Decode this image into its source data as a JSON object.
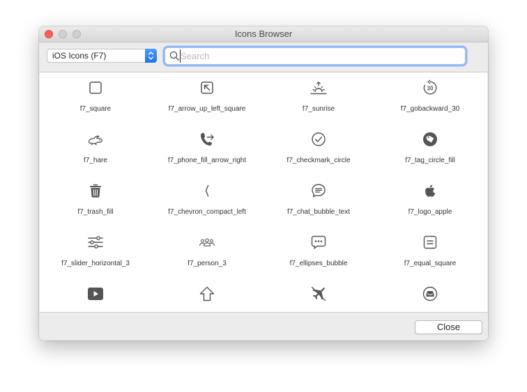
{
  "window": {
    "title": "Icons Browser"
  },
  "toolbar": {
    "icon_set": "iOS Icons (F7)",
    "search": {
      "value": "",
      "placeholder": "Search"
    }
  },
  "icons": [
    {
      "label": "f7_square",
      "icon": "square-icon"
    },
    {
      "label": "f7_arrow_up_left_square",
      "icon": "arrow-up-left-square-icon"
    },
    {
      "label": "f7_sunrise",
      "icon": "sunrise-icon"
    },
    {
      "label": "f7_gobackward_30",
      "icon": "gobackward-30-icon"
    },
    {
      "label": "f7_hare",
      "icon": "hare-icon"
    },
    {
      "label": "f7_phone_fill_arrow_right",
      "icon": "phone-fill-arrow-right-icon"
    },
    {
      "label": "f7_checkmark_circle",
      "icon": "checkmark-circle-icon"
    },
    {
      "label": "f7_tag_circle_fill",
      "icon": "tag-circle-fill-icon"
    },
    {
      "label": "f7_trash_fill",
      "icon": "trash-fill-icon"
    },
    {
      "label": "f7_chevron_compact_left",
      "icon": "chevron-compact-left-icon"
    },
    {
      "label": "f7_chat_bubble_text",
      "icon": "chat-bubble-text-icon"
    },
    {
      "label": "f7_logo_apple",
      "icon": "logo-apple-icon"
    },
    {
      "label": "f7_slider_horizontal_3",
      "icon": "slider-horizontal-3-icon"
    },
    {
      "label": "f7_person_3",
      "icon": "person-3-icon"
    },
    {
      "label": "f7_ellipses_bubble",
      "icon": "ellipses-bubble-icon"
    },
    {
      "label": "f7_equal_square",
      "icon": "equal-square-icon"
    },
    {
      "label": "",
      "icon": "play-rectangle-fill-icon"
    },
    {
      "label": "",
      "icon": "arrow-up-outline-icon"
    },
    {
      "label": "",
      "icon": "airplane-slash-icon"
    },
    {
      "label": "",
      "icon": "tray-circle-icon"
    }
  ],
  "icon_color": "#555555",
  "accent_color": "#2a7ae8",
  "footer": {
    "close_label": "Close"
  }
}
